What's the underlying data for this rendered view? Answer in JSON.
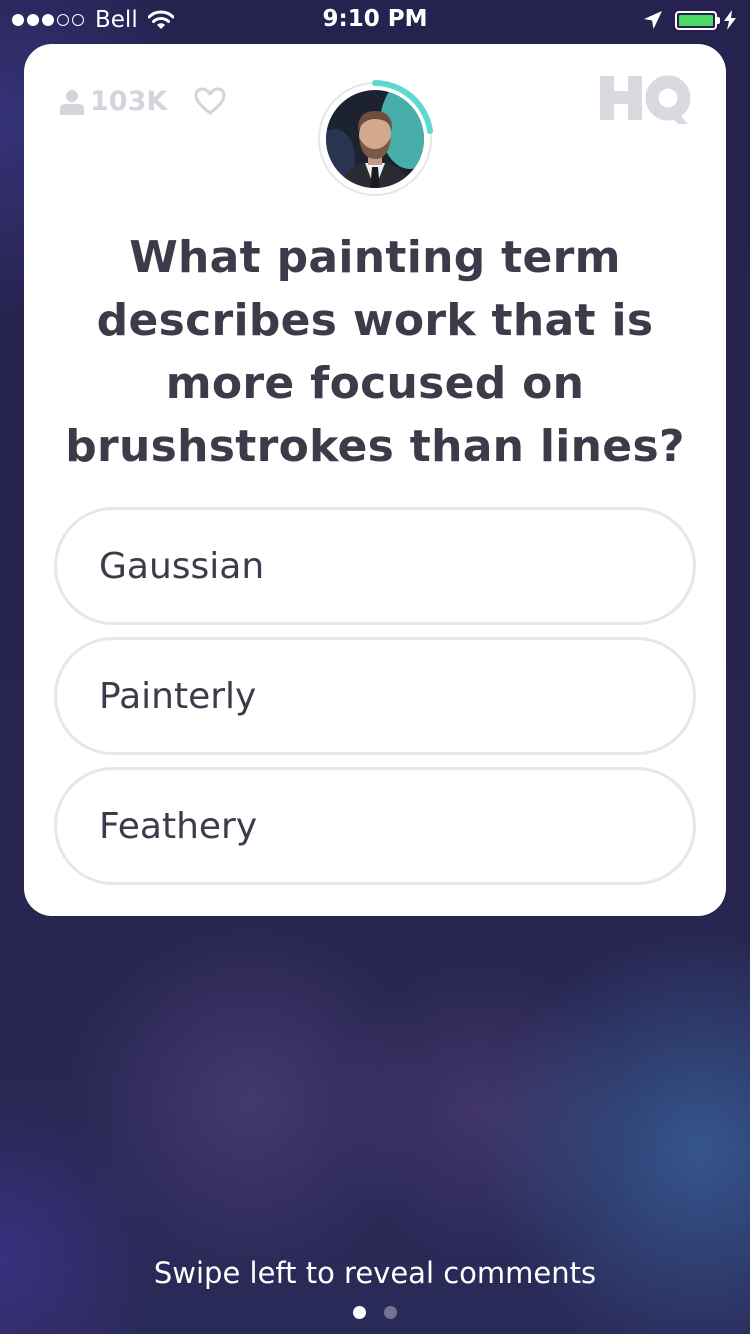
{
  "status_bar": {
    "carrier": "Bell",
    "time": "9:10 PM",
    "signal_bars_filled": 3,
    "signal_bars_total": 5,
    "battery_level": 1.0,
    "battery_color": "#4cd964",
    "icons": [
      "wifi-icon",
      "location-arrow-icon",
      "battery-icon",
      "charging-bolt-icon"
    ]
  },
  "card": {
    "viewer_count": "103K",
    "viewer_icon": "person-icon",
    "like_icon": "heart-icon",
    "logo": "HQ",
    "host_avatar": "host-avatar",
    "timer_color": "#5fd9d0",
    "question": "What painting term describes work that is more focused on brushstrokes than lines?",
    "answers": [
      {
        "label": "Gaussian"
      },
      {
        "label": "Painterly"
      },
      {
        "label": "Feathery"
      }
    ]
  },
  "footer": {
    "swipe_hint": "Swipe left to reveal comments",
    "pages_total": 2,
    "active_page": 1
  },
  "colors": {
    "background": "#27244e",
    "card": "#ffffff",
    "text_dark": "#3b3b4a",
    "muted": "#d4d4dc",
    "answer_border": "#e7e7ea"
  }
}
